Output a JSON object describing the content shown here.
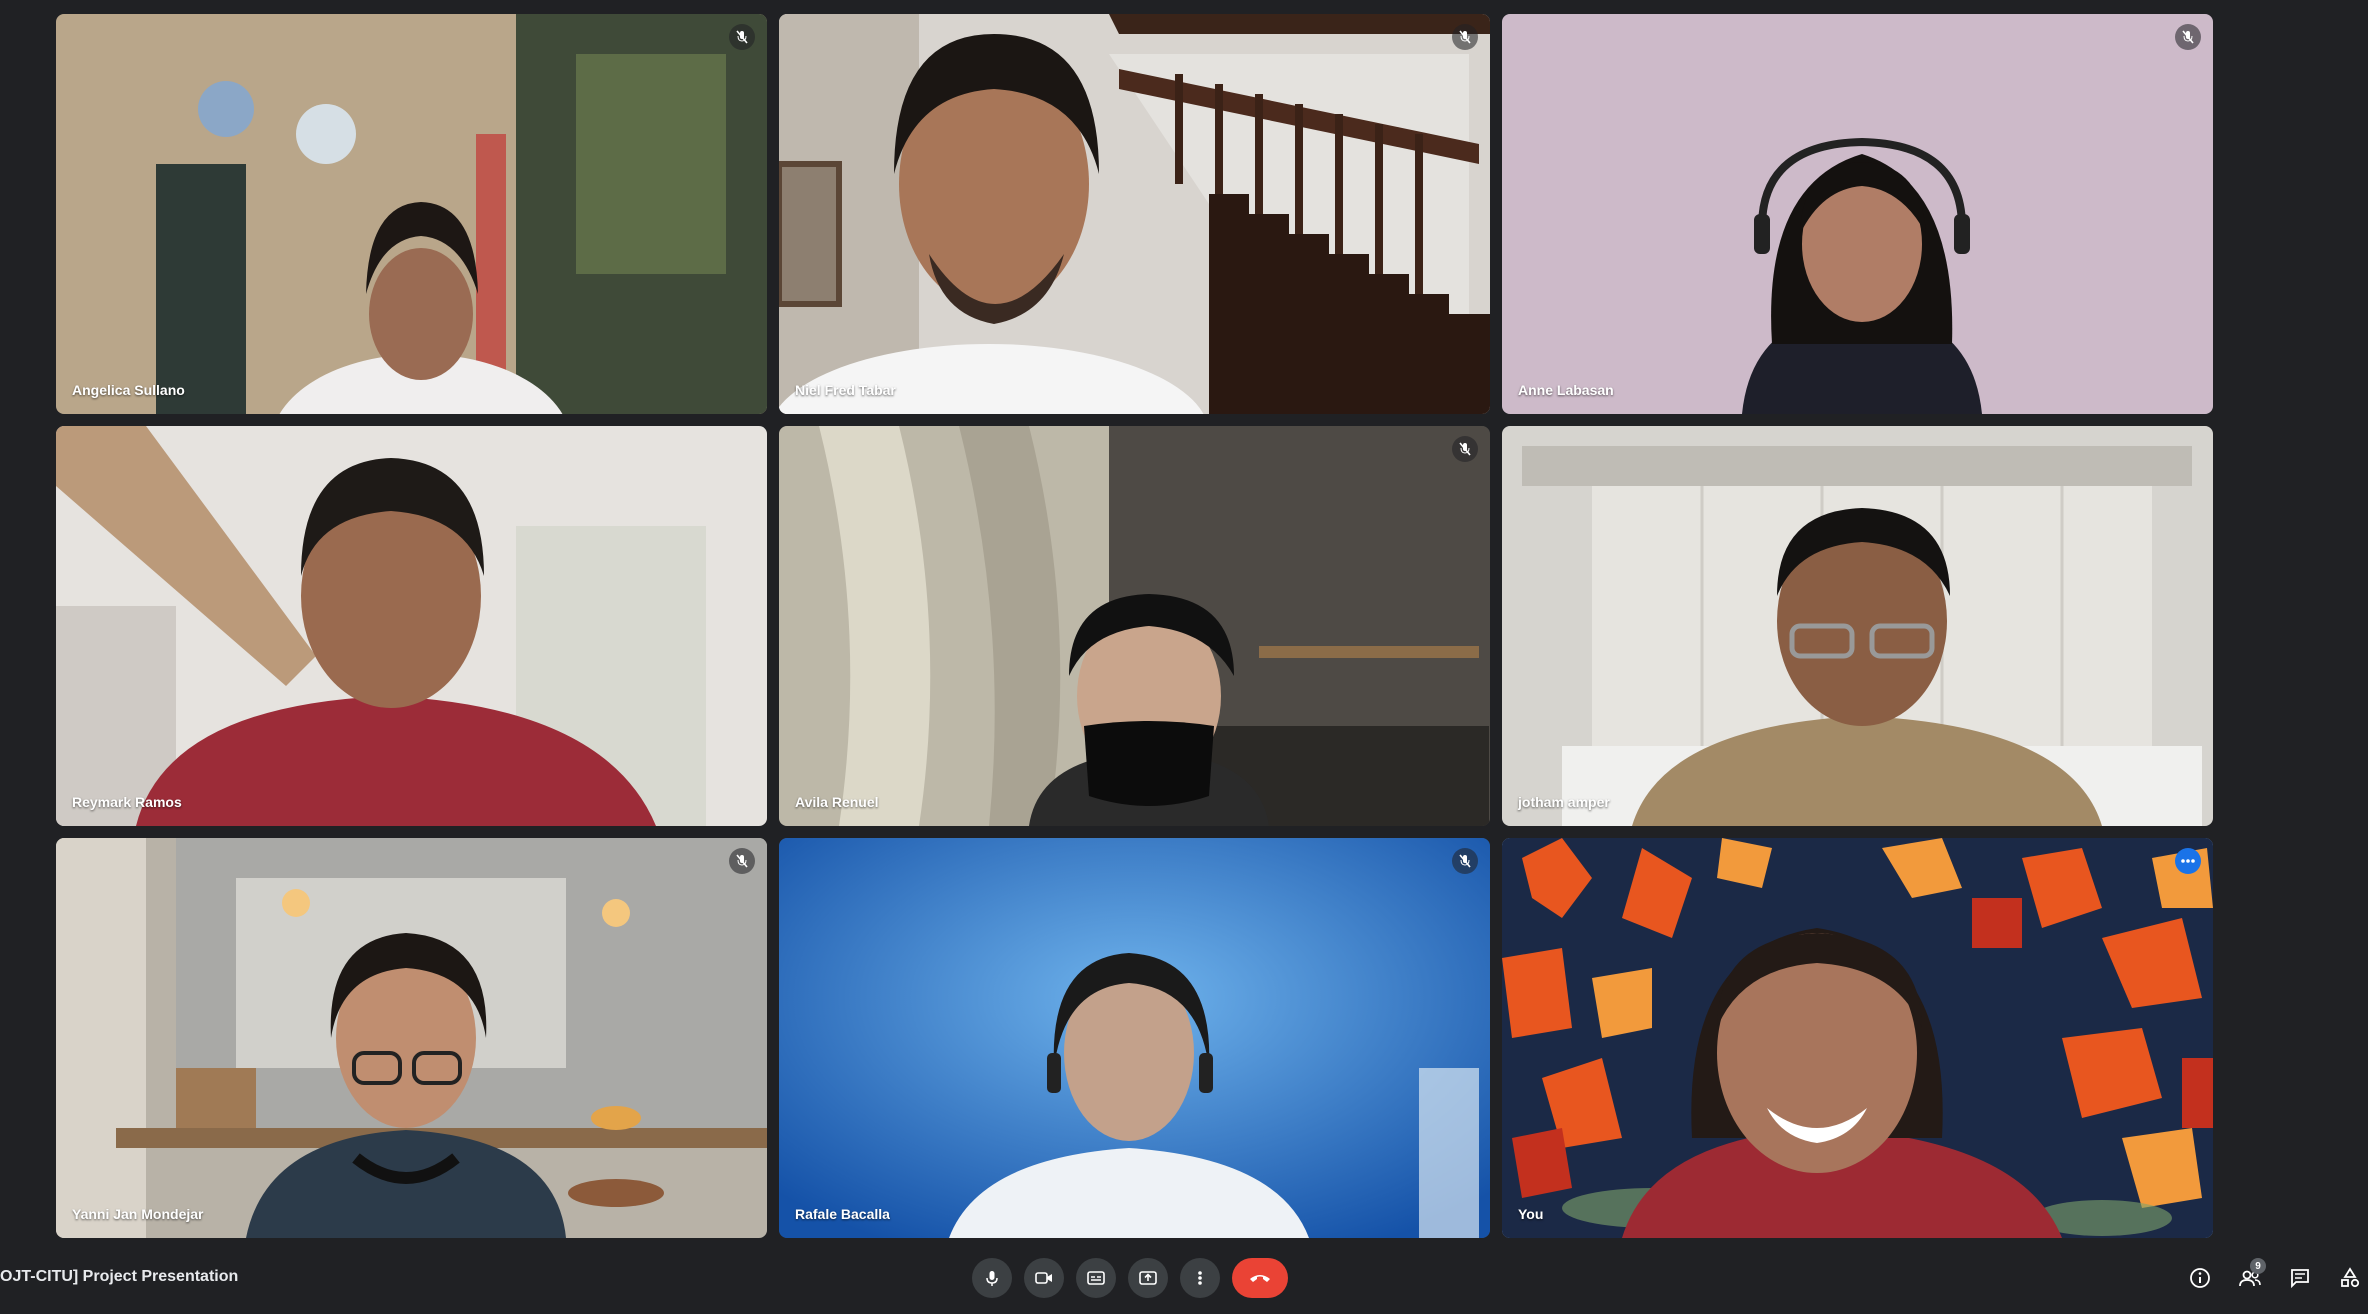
{
  "meeting": {
    "title": "OJT-CITU] Project Presentation",
    "participant_count": "9"
  },
  "colors": {
    "background": "#202124",
    "tile_border_active": "#8ab4f8",
    "end_call": "#ea4335",
    "control_bg": "#3c4043"
  },
  "tiles": [
    {
      "name": "Angelica Sullano",
      "muted": true,
      "bg": "#b7a88c",
      "skin": "#9a6b53",
      "shirt": "#f1efef",
      "hair": "#1d1714"
    },
    {
      "name": "Niel Fred Tabar",
      "muted": true,
      "bg": "#cfcac4",
      "skin": "#a87658",
      "shirt": "#f5f5f5",
      "hair": "#1b1613"
    },
    {
      "name": "Anne Labasan",
      "muted": true,
      "bg": "#cbb8c8",
      "skin": "#b07d66",
      "shirt": "#1e1f2a",
      "hair": "#14110f"
    },
    {
      "name": "Reymark Ramos",
      "muted": false,
      "bg": "#e3dfda",
      "skin": "#9a6a4f",
      "shirt": "#9c2c38",
      "hair": "#1e1a17"
    },
    {
      "name": "Avila Renuel",
      "muted": true,
      "bg": "#59554f",
      "skin": "#c9a58c",
      "shirt": "#2a2a2a",
      "hair": "#111111"
    },
    {
      "name": "jotham amper",
      "muted": false,
      "bg": "#dcdad5",
      "skin": "#8a5e44",
      "shirt": "#a38a66",
      "hair": "#141211"
    },
    {
      "name": "Yanni Jan Mondejar",
      "muted": true,
      "bg": "#b9b3a8",
      "skin": "#c08e70",
      "shirt": "#2c3b4a",
      "hair": "#1c1714"
    },
    {
      "name": "Rafale Bacalla",
      "muted": true,
      "bg": "#2f78c8",
      "skin": "#c3a18b",
      "shirt": "#eef2f6",
      "hair": "#1a1a1a"
    },
    {
      "name": "You",
      "muted": false,
      "active": true,
      "bg": "#1b2946",
      "skin": "#a8755c",
      "shirt": "#9d2a33",
      "hair": "#231a16"
    }
  ],
  "controls": [
    "mic-icon",
    "camera-icon",
    "captions-icon",
    "present-icon",
    "more-options-icon",
    "end-call-icon"
  ],
  "right_icons": [
    "info-icon",
    "people-icon",
    "chat-icon",
    "activities-icon"
  ]
}
